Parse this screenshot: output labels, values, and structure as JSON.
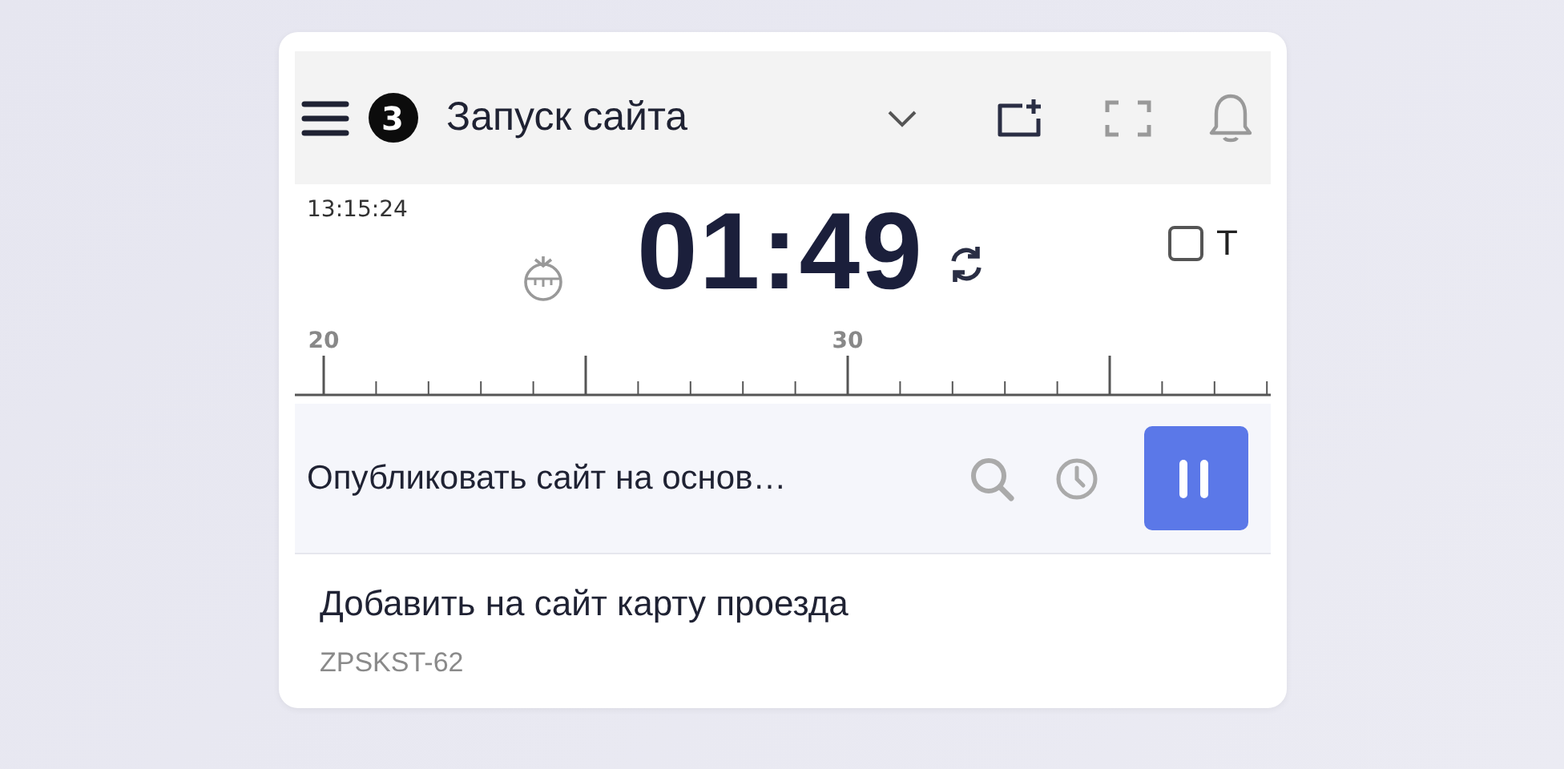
{
  "header": {
    "badge": "3",
    "title": "Запуск сайта"
  },
  "timer": {
    "clock": "13:15:24",
    "elapsed": "01:49",
    "checkbox": {
      "label": "T",
      "checked": false
    }
  },
  "ruler": {
    "labels": [
      "20",
      "30"
    ]
  },
  "current_task": {
    "title": "Опубликовать сайт на основ…",
    "running": true
  },
  "next_task": {
    "title": "Добавить на сайт карту проезда",
    "key": "ZPSKST-62"
  }
}
